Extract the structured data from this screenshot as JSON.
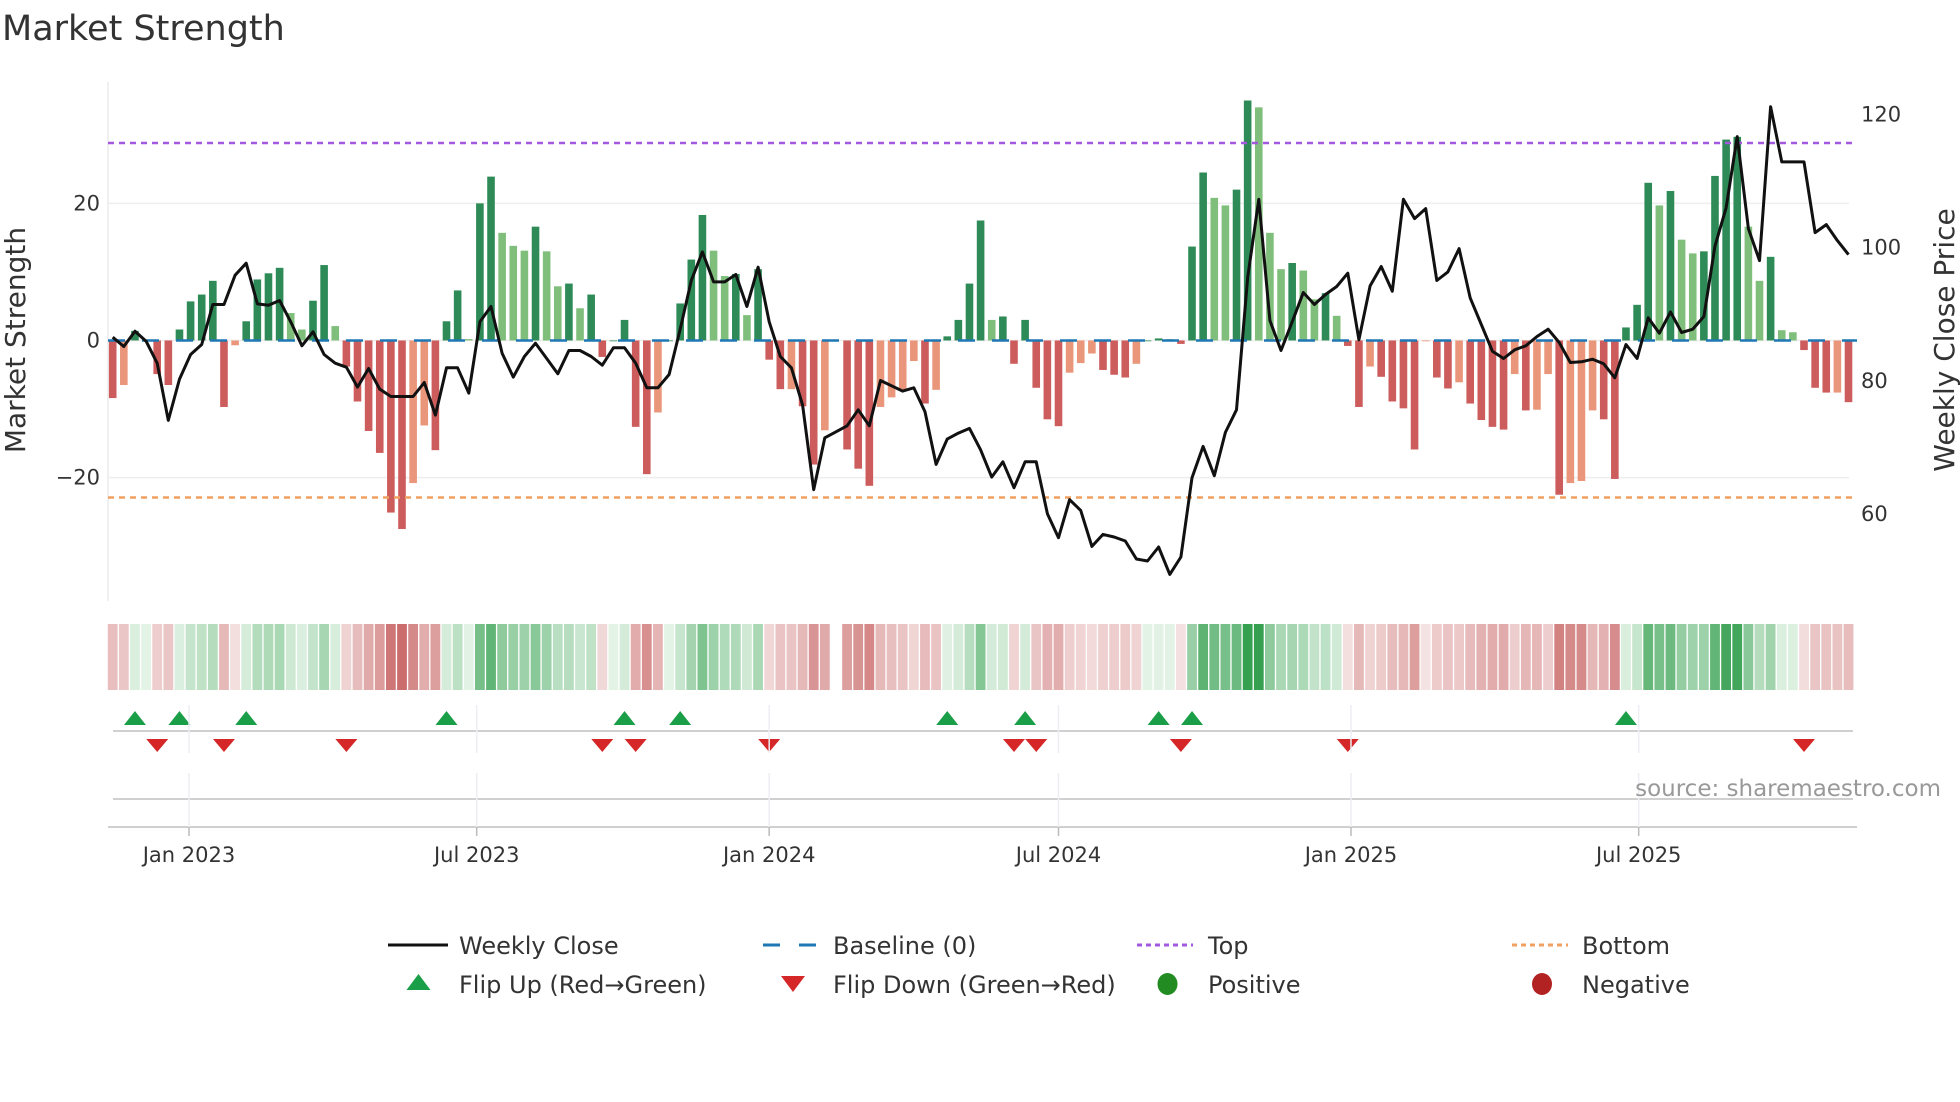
{
  "title": "Market Strength",
  "source": "source: sharemaestro.com",
  "colors": {
    "green_dark": "#2e8b57",
    "green_light": "#7fbf7b",
    "red_dark": "#cd5c5c",
    "red_light": "#e9967a",
    "price_line": "#111111",
    "baseline": "#1f77b4",
    "top": "#a259e0",
    "bottom": "#f0a060",
    "flip_up": "#1a9e47",
    "flip_down": "#d62728",
    "positive": "#228b22",
    "negative": "#b22222"
  },
  "legend": [
    {
      "label": "Weekly Close",
      "icon": "line-solid-icon"
    },
    {
      "label": "Baseline (0)",
      "icon": "line-dashed-icon"
    },
    {
      "label": "Top",
      "icon": "line-dotted-purple-icon"
    },
    {
      "label": "Bottom",
      "icon": "line-dotted-orange-icon"
    },
    {
      "label": "Flip Up (Red→Green)",
      "icon": "triangle-up-icon"
    },
    {
      "label": "Flip Down (Green→Red)",
      "icon": "triangle-down-icon"
    },
    {
      "label": "Positive",
      "icon": "circle-green-icon"
    },
    {
      "label": "Negative",
      "icon": "circle-red-icon"
    }
  ],
  "chart_data": {
    "type": "bar",
    "title": "Market Strength",
    "ylabel": "Market Strength",
    "y2label": "Weekly Close Price",
    "frequency": "weekly",
    "start_week": "2022-11-14",
    "ylim": [
      -38,
      37.7
    ],
    "y2lim": [
      46.8,
      124.7
    ],
    "yticks": [
      {
        "value": 20,
        "label": "20"
      },
      {
        "value": 0,
        "label": "0"
      },
      {
        "value": -20,
        "label": "−20"
      }
    ],
    "y2ticks": [
      {
        "value": 120,
        "label": "120"
      },
      {
        "value": 100,
        "label": "100"
      },
      {
        "value": 80,
        "label": "80"
      },
      {
        "value": 60,
        "label": "60"
      }
    ],
    "xticks": [
      {
        "date": "2023-01-01",
        "label": "Jan 2023"
      },
      {
        "date": "2023-07-01",
        "label": "Jul 2023"
      },
      {
        "date": "2024-01-01",
        "label": "Jan 2024"
      },
      {
        "date": "2024-07-01",
        "label": "Jul 2024"
      },
      {
        "date": "2025-01-01",
        "label": "Jan 2025"
      },
      {
        "date": "2025-07-01",
        "label": "Jul 2025"
      }
    ],
    "top_level": 28.8,
    "bottom_level": -22.9,
    "baseline": 0,
    "strength": [
      -8.4,
      -6.5,
      1.4,
      0,
      -4.9,
      -6.5,
      1.6,
      5.7,
      6.7,
      8.7,
      -9.7,
      -0.7,
      2.8,
      8.9,
      9.8,
      10.6,
      4.0,
      1.6,
      5.8,
      11.0,
      2.1,
      -3.8,
      -8.9,
      -13.2,
      -16.4,
      -25.1,
      -27.5,
      -20.8,
      -12.4,
      -16.0,
      2.8,
      7.3,
      0.2,
      20.0,
      23.9,
      15.7,
      13.8,
      13.1,
      16.6,
      13.0,
      7.9,
      8.3,
      4.7,
      6.7,
      -2.4,
      0,
      3.0,
      -12.6,
      -19.5,
      -10.5,
      0,
      5.4,
      11.8,
      18.3,
      13.1,
      9.4,
      9.7,
      3.7,
      10.4,
      -2.8,
      -7.1,
      -7.1,
      -9.6,
      -18.1,
      -13.1,
      null,
      -15.9,
      -18.7,
      -21.2,
      -9.7,
      -8.3,
      -7.3,
      -3.0,
      -9.2,
      -7.2,
      0.6,
      3.0,
      8.3,
      17.5,
      3.0,
      3.5,
      -3.4,
      3.0,
      -6.9,
      -11.5,
      -12.5,
      -4.7,
      -3.3,
      -1.9,
      -4.3,
      -5.0,
      -5.4,
      -3.4,
      0,
      0.3,
      0.2,
      -0.5,
      13.7,
      24.5,
      20.8,
      19.7,
      22.0,
      35.0,
      34.0,
      15.7,
      10.4,
      11.3,
      10.2,
      6.0,
      6.9,
      3.6,
      -0.8,
      -9.7,
      -3.8,
      -5.3,
      -8.9,
      -9.9,
      -15.9,
      -0.1,
      -5.4,
      -7.0,
      -6.1,
      -9.2,
      -11.6,
      -12.6,
      -13.0,
      -4.9,
      -10.2,
      -10.1,
      -4.9,
      -22.5,
      -20.8,
      -20.5,
      -10.2,
      -11.5,
      -20.2,
      1.9,
      5.2,
      23.0,
      19.7,
      21.8,
      14.7,
      12.7,
      13.0,
      24.0,
      29.3,
      29.7,
      16.6,
      8.7,
      12.2,
      1.5,
      1.2,
      -1.4,
      -6.9,
      -7.6,
      -7.6,
      -9.0
    ],
    "weekly_close": [
      86.4,
      85.0,
      87.3,
      85.8,
      82.5,
      73.9,
      80.1,
      83.8,
      85.3,
      91.3,
      91.3,
      95.7,
      97.5,
      91.4,
      91.2,
      91.9,
      88.7,
      85.1,
      87.2,
      83.8,
      82.5,
      81.9,
      78.9,
      81.7,
      78.6,
      77.5,
      77.5,
      77.5,
      79.6,
      74.7,
      81.8,
      81.8,
      78.0,
      88.7,
      91.0,
      84.0,
      80.4,
      83.5,
      85.5,
      83.2,
      80.9,
      84.4,
      84.4,
      83.5,
      82.2,
      84.8,
      84.8,
      82.5,
      78.8,
      78.8,
      80.8,
      87.6,
      94.9,
      99.2,
      94.7,
      94.7,
      95.8,
      91.0,
      96.9,
      88.7,
      83.5,
      81.8,
      76.2,
      63.5,
      71.3,
      72.2,
      73.1,
      75.5,
      73.1,
      79.9,
      79.1,
      78.3,
      78.8,
      75.2,
      67.3,
      71.1,
      72.0,
      72.7,
      69.5,
      65.4,
      67.7,
      63.8,
      67.7,
      67.7,
      59.9,
      56.3,
      62.0,
      60.4,
      55.0,
      56.8,
      56.4,
      55.8,
      53.1,
      52.8,
      54.9,
      50.8,
      53.4,
      65.3,
      70.0,
      65.6,
      72.1,
      75.5,
      95.4,
      107.1,
      88.9,
      84.4,
      88.7,
      93.1,
      91.3,
      92.8,
      94.0,
      96.0,
      86.0,
      94.1,
      97.0,
      93.3,
      107.1,
      104.2,
      105.7,
      94.9,
      96.2,
      99.7,
      92.3,
      88.3,
      84.3,
      83.2,
      84.5,
      85.1,
      86.5,
      87.6,
      85.6,
      82.6,
      82.7,
      83.1,
      82.4,
      80.3,
      85.3,
      83.2,
      89.3,
      87.0,
      90.2,
      87.1,
      87.6,
      89.5,
      100.1,
      105.8,
      116.5,
      102.7,
      97.9,
      121.0,
      112.7,
      112.7,
      112.7,
      102.1,
      103.3,
      100.9,
      98.8
    ],
    "flip_up_weeks": [
      2,
      6,
      12,
      30,
      46,
      51,
      75,
      82,
      94,
      97,
      136
    ],
    "flip_down_weeks": [
      4,
      10,
      21,
      44,
      47,
      59,
      81,
      83,
      96,
      111,
      152
    ],
    "legend_placement": "bottom"
  }
}
